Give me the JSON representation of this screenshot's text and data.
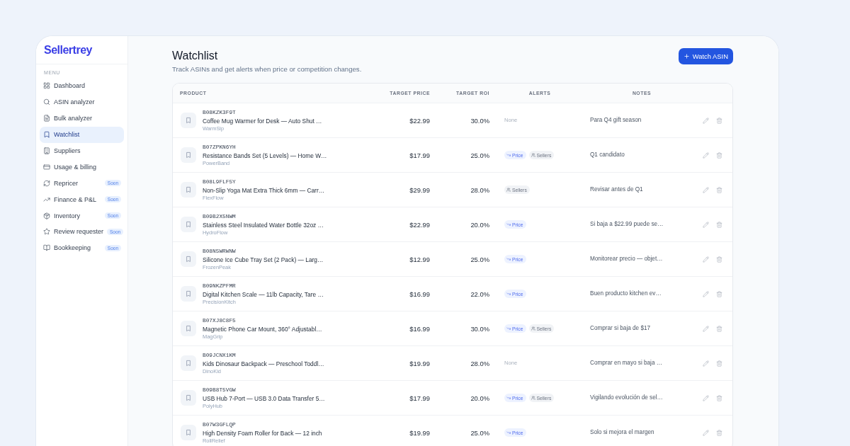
{
  "sidebar": {
    "logo": "Sellertrey",
    "section_label": "MENU",
    "items": [
      {
        "label": "Dashboard",
        "selected": false
      },
      {
        "label": "ASIN analyzer",
        "selected": false
      },
      {
        "label": "Bulk analyzer",
        "selected": false
      },
      {
        "label": "Watchlist",
        "selected": true
      },
      {
        "label": "Suppliers",
        "selected": false
      },
      {
        "label": "Usage & billing",
        "selected": false
      },
      {
        "label": "Repricer",
        "selected": false,
        "badge": "Soon"
      },
      {
        "label": "Finance & P&L",
        "selected": false,
        "badge": "Soon"
      },
      {
        "label": "Inventory",
        "selected": false,
        "badge": "Soon"
      },
      {
        "label": "Review requester",
        "selected": false,
        "badge": "Soon"
      },
      {
        "label": "Bookkeeping",
        "selected": false,
        "badge": "Soon"
      }
    ]
  },
  "header": {
    "title": "Watchlist",
    "subtitle": "Track ASINs and get alerts when price or competition changes.",
    "action_button": "Watch ASIN"
  },
  "table": {
    "columns": [
      "PRODUCT",
      "TARGET PRICE",
      "TARGET ROI",
      "ALERTS",
      "NOTES"
    ],
    "rows": [
      {
        "asin": "B08KZK3F9T",
        "title": "Coffee Mug Warmer for Desk — Auto Shut …",
        "brand": "WarmSip",
        "target_price": "$22.99",
        "target_roi": "30.0%",
        "alerts_text": "None",
        "notes": "Para Q4 gift season"
      },
      {
        "asin": "B07ZPKN6YH",
        "title": "Resistance Bands Set (5 Levels) — Home W…",
        "brand": "PowerBand",
        "target_price": "$17.99",
        "target_roi": "25.0%",
        "alerts": [
          {
            "kind": "price",
            "label": "Price"
          },
          {
            "kind": "sellers",
            "label": "Sellers"
          }
        ],
        "notes": "Q1 candidato"
      },
      {
        "asin": "B08L9FLF5Y",
        "title": "Non-Slip Yoga Mat Extra Thick 6mm — Carr…",
        "brand": "FlexFlow",
        "target_price": "$29.99",
        "target_roi": "28.0%",
        "alerts": [
          {
            "kind": "sellers",
            "label": "Sellers"
          }
        ],
        "notes": "Revisar antes de Q1"
      },
      {
        "asin": "B09B2X5NWM",
        "title": "Stainless Steel Insulated Water Bottle 32oz …",
        "brand": "HydroFlow",
        "target_price": "$22.99",
        "target_roi": "20.0%",
        "alerts": [
          {
            "kind": "price",
            "label": "Price"
          }
        ],
        "notes": "Si baja a $22.99 puede se…"
      },
      {
        "asin": "B08N5WRWNW",
        "title": "Silicone Ice Cube Tray Set (2 Pack) — Larg…",
        "brand": "FrozenPeak",
        "target_price": "$12.99",
        "target_roi": "25.0%",
        "alerts": [
          {
            "kind": "price",
            "label": "Price"
          }
        ],
        "notes": "Monitorear precio — objet…"
      },
      {
        "asin": "B09NKZPFMR",
        "title": "Digital Kitchen Scale — 11lb Capacity, Tare …",
        "brand": "PrecisionKitch",
        "target_price": "$16.99",
        "target_roi": "22.0%",
        "alerts": [
          {
            "kind": "price",
            "label": "Price"
          }
        ],
        "notes": "Buen producto kitchen ev…"
      },
      {
        "asin": "B07XJ8C8F5",
        "title": "Magnetic Phone Car Mount, 360° Adjustabl…",
        "brand": "MagGrip",
        "target_price": "$16.99",
        "target_roi": "30.0%",
        "alerts": [
          {
            "kind": "price",
            "label": "Price"
          },
          {
            "kind": "sellers",
            "label": "Sellers"
          }
        ],
        "notes": "Comprar si baja de $17"
      },
      {
        "asin": "B09JCNX1KM",
        "title": "Kids Dinosaur Backpack — Preschool Toddl…",
        "brand": "DinoKid",
        "target_price": "$19.99",
        "target_roi": "28.0%",
        "alerts_text": "None",
        "notes": "Comprar en mayo si baja …"
      },
      {
        "asin": "B09B8T5VGW",
        "title": "USB Hub 7-Port — USB 3.0 Data Transfer 5…",
        "brand": "PolyHub",
        "target_price": "$17.99",
        "target_roi": "20.0%",
        "alerts": [
          {
            "kind": "price",
            "label": "Price"
          },
          {
            "kind": "sellers",
            "label": "Sellers"
          }
        ],
        "notes": "Vigilando evolución de sel…"
      },
      {
        "asin": "B07W3GFLQP",
        "title": "High Density Foam Roller for Back — 12 inch",
        "brand": "RollRelief",
        "target_price": "$19.99",
        "target_roi": "25.0%",
        "alerts": [
          {
            "kind": "price",
            "label": "Price"
          }
        ],
        "notes": "Solo si mejora el margen"
      }
    ]
  }
}
